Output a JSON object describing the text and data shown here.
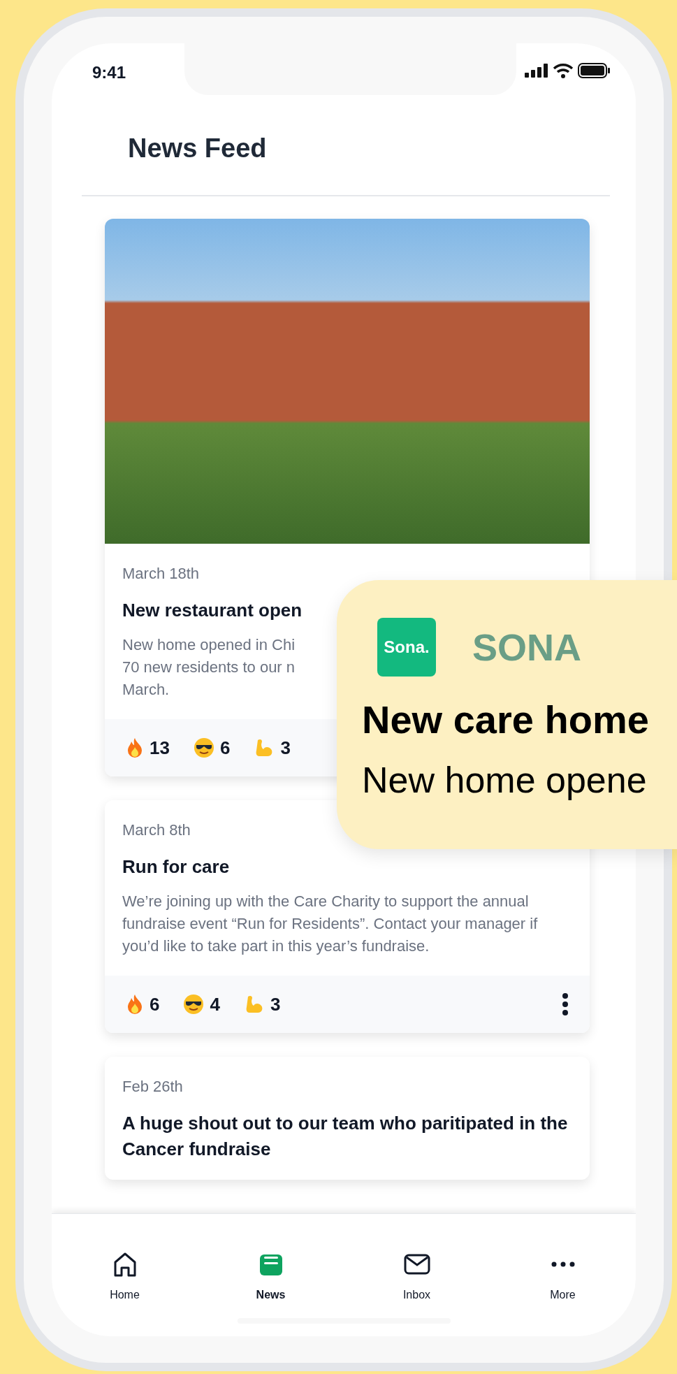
{
  "status_bar": {
    "time": "9:41"
  },
  "header": {
    "title": "News Feed"
  },
  "posts": [
    {
      "has_photo": true,
      "date": "March 18th",
      "title": "New restaurant open",
      "body_lines": [
        "New home opened in Chi",
        "70 new residents to our n",
        "March."
      ],
      "reactions": [
        {
          "kind": "fire",
          "count": "13"
        },
        {
          "kind": "cool",
          "count": "6"
        },
        {
          "kind": "strong",
          "count": "3"
        }
      ],
      "has_menu": false
    },
    {
      "has_photo": false,
      "date": "March 8th",
      "title": "Run for care",
      "body_lines": [
        "We’re joining up with the Care Charity to support the annual fundraise event “Run for Residents”. Contact your manager if you’d like to take part in this year’s fundraise."
      ],
      "reactions": [
        {
          "kind": "fire",
          "count": "6"
        },
        {
          "kind": "cool",
          "count": "4"
        },
        {
          "kind": "strong",
          "count": "3"
        }
      ],
      "has_menu": true
    },
    {
      "has_photo": false,
      "date": "Feb 26th",
      "title": "A huge shout out to our team who paritipated in the Cancer fundraise"
    }
  ],
  "notification": {
    "logo": "Sona.",
    "app": "SONA",
    "title": "New care home",
    "body": "New home opene"
  },
  "tab_bar": [
    {
      "kind": "home",
      "label": "Home",
      "selected": false
    },
    {
      "kind": "news",
      "label": "News",
      "selected": true
    },
    {
      "kind": "inbox",
      "label": "Inbox",
      "selected": false
    },
    {
      "kind": "more",
      "label": "More",
      "selected": false
    }
  ]
}
